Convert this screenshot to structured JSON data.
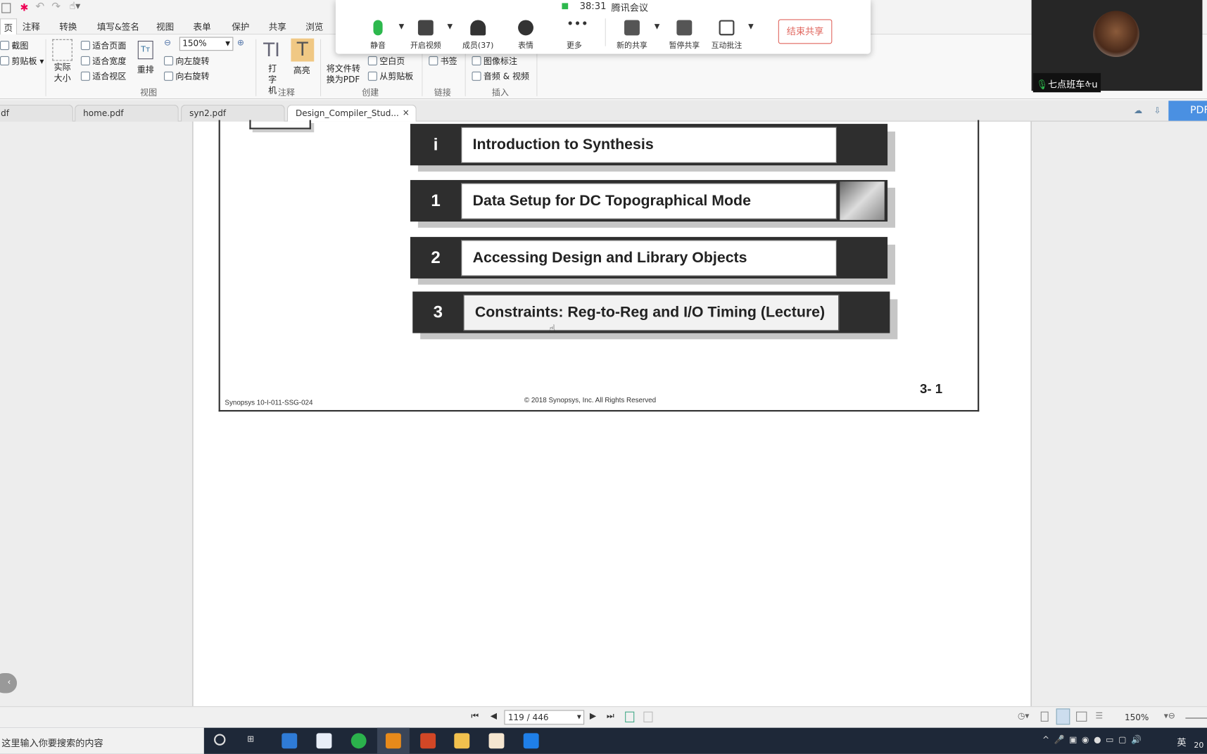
{
  "ribbon_tabs": [
    "页",
    "注释",
    "转换",
    "填写&签名",
    "视图",
    "表单",
    "保护",
    "共享",
    "浏览"
  ],
  "ribbon": {
    "screenshot": "截图",
    "clipboard": "剪贴板",
    "actual_size": "实际大小",
    "fit_page": "适合页面",
    "fit_width": "适合宽度",
    "fit_view": "适合视区",
    "reflow": "重排",
    "zoom_value": "150%",
    "rotate_left": "向左旋转",
    "rotate_right": "向右旋转",
    "group_view": "视图",
    "typewriter": "打字机",
    "highlight": "高亮",
    "group_annotate": "注释",
    "convert_pdf": "将文件转换为PDF",
    "blank_page": "空白页",
    "from_clipboard": "从剪贴板",
    "group_create": "创建",
    "bookmark": "书签",
    "group_link": "链接",
    "image_annot": "图像标注",
    "audio_video": "音频 & 视频",
    "group_insert": "插入"
  },
  "doc_tabs": [
    {
      "label": "df"
    },
    {
      "label": "home.pdf"
    },
    {
      "label": "syn2.pdf"
    },
    {
      "label": "Design_Compiler_Stud...",
      "active": true
    }
  ],
  "doc_tab_close": "×",
  "pdf_button": "PDF",
  "pdf_page": {
    "chapters": [
      {
        "num": "i",
        "title": "Introduction to Synthesis"
      },
      {
        "num": "1",
        "title": "Data Setup for DC Topographical Mode"
      },
      {
        "num": "2",
        "title": "Accessing Design and Library Objects"
      },
      {
        "num": "3",
        "title": "Constraints: Reg-to-Reg and I/O Timing (Lecture)"
      }
    ],
    "footer_left": "Synopsys 10-I-011-SSG-024",
    "footer_center": "© 2018 Synopsys, Inc. All Rights Reserved",
    "page_label": "3- 1"
  },
  "status": {
    "page_value": "119 / 446",
    "zoom": "150%"
  },
  "taskbar": {
    "search_placeholder": "这里输入你要搜索的内容",
    "ime": "英",
    "clock_partial": "20"
  },
  "meeting": {
    "timer": "38:31",
    "app_name": "腾讯会议",
    "buttons": [
      "静音",
      "开启视频",
      "成员(37)",
      "表情",
      "更多",
      "新的共享",
      "暂停共享",
      "互动批注"
    ],
    "end_share": "结束共享",
    "signal_color": "#2db84d",
    "end_color": "#e0665e"
  },
  "video": {
    "participant": "七点班车ᡧu"
  }
}
